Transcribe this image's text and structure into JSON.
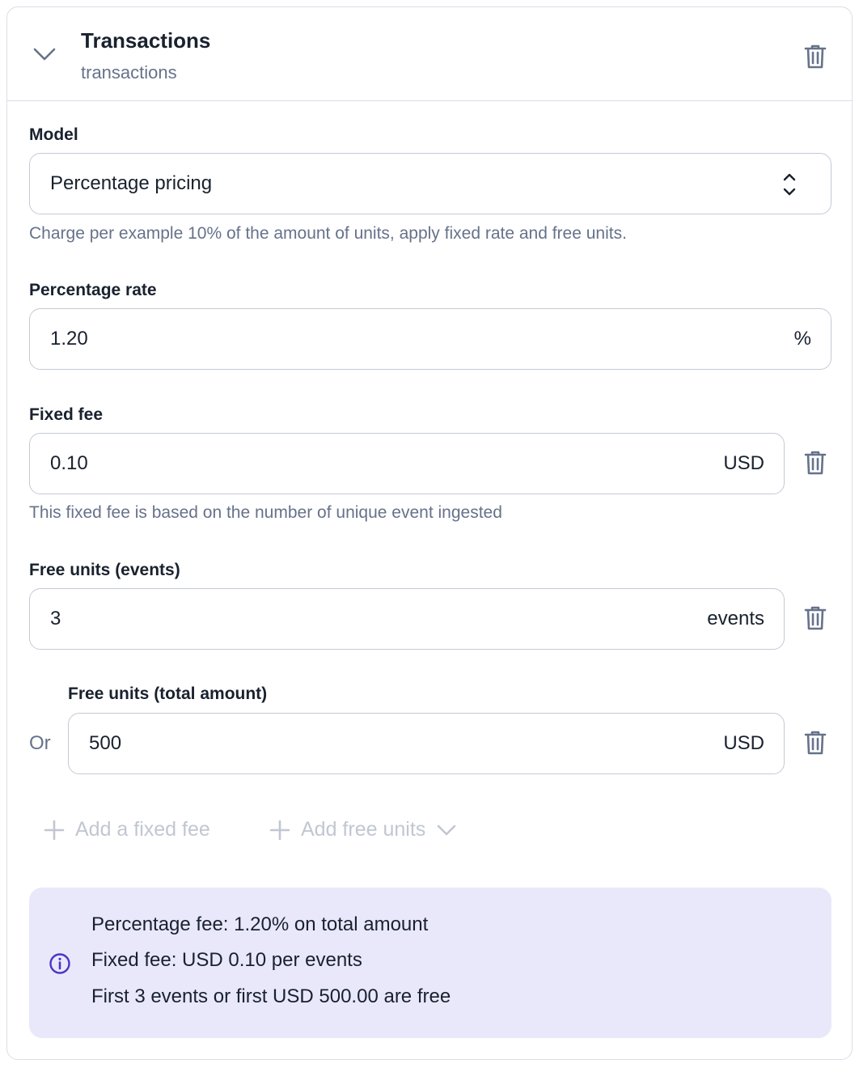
{
  "header": {
    "title": "Transactions",
    "subtitle": "transactions",
    "collapse_icon": "chevron-down-icon",
    "delete_icon": "trash-icon"
  },
  "model": {
    "label": "Model",
    "value": "Percentage pricing",
    "help": "Charge per example 10% of the amount of units, apply fixed rate and free units."
  },
  "percentage_rate": {
    "label": "Percentage rate",
    "value": "1.20",
    "suffix": "%"
  },
  "fixed_fee": {
    "label": "Fixed fee",
    "value": "0.10",
    "suffix": "USD",
    "help": "This fixed fee is based on the number of unique event ingested"
  },
  "free_units_events": {
    "label": "Free units (events)",
    "value": "3",
    "suffix": "events"
  },
  "free_units_amount": {
    "or_label": "Or",
    "label": "Free units (total amount)",
    "value": "500",
    "suffix": "USD"
  },
  "actions": {
    "add_fixed_fee": "Add a fixed fee",
    "add_free_units": "Add free units"
  },
  "summary": {
    "lines": [
      "Percentage fee: 1.20% on total amount",
      "Fixed fee: USD 0.10 per events",
      "First 3 events or first USD 500.00 are free"
    ]
  },
  "colors": {
    "text": "#19212e",
    "muted": "#66728a",
    "border": "#c4cad4",
    "disabled": "#c1c7d1",
    "info_bg": "#e9e8fb",
    "info_accent": "#4b35c4"
  }
}
